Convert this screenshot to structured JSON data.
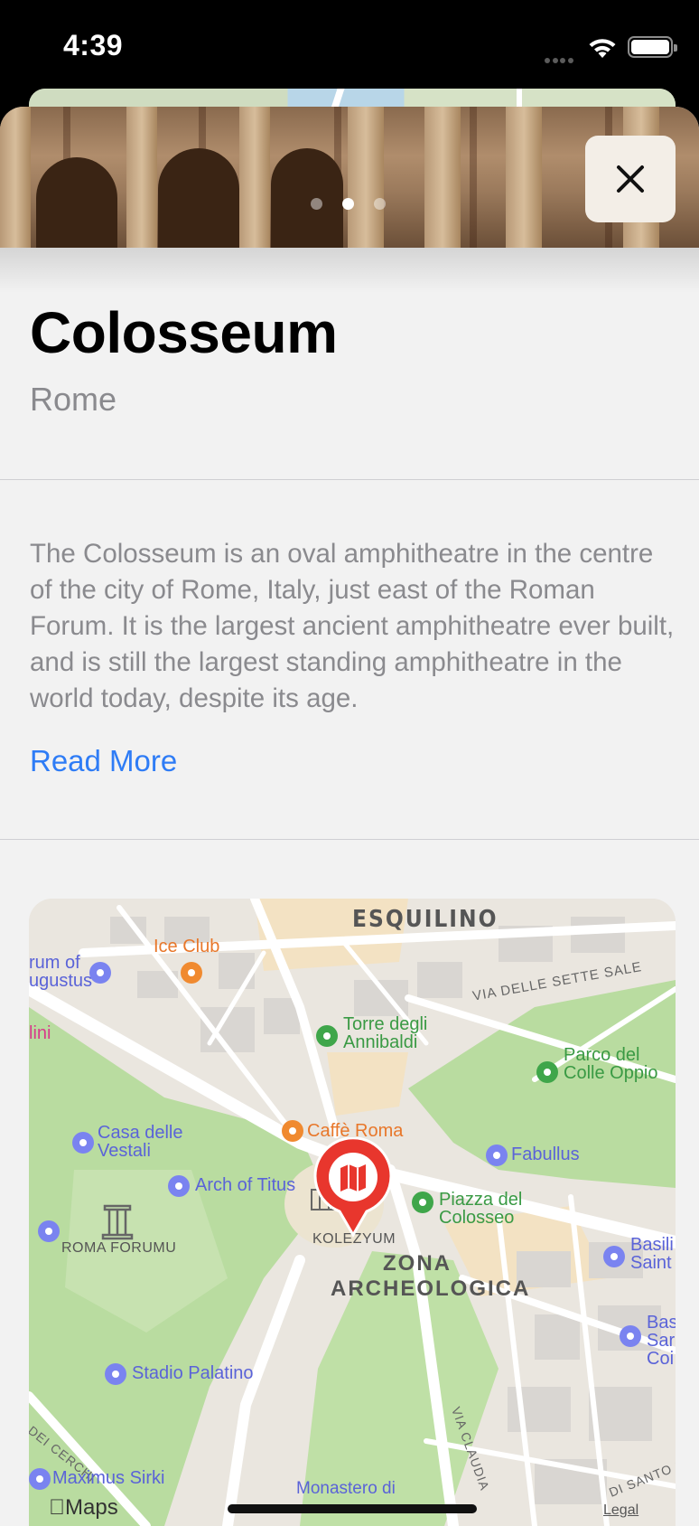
{
  "status_bar": {
    "time": "4:39"
  },
  "place": {
    "title": "Colosseum",
    "city": "Rome",
    "description": "The Colosseum is an oval amphitheatre in the centre of the city of Rome, Italy, just east of the Roman Forum. It is the largest ancient amphitheatre ever built, and is still the largest standing amphitheatre in the world today, despite its age.",
    "read_more": "Read More"
  },
  "gallery": {
    "page_count": 3,
    "active_page": 2
  },
  "map": {
    "labels": {
      "esquilino": "ESQUILINO",
      "ice_club": "Ice Club",
      "forum_augustus_1": "rum of",
      "forum_augustus_2": "ugustus",
      "lini": "lini",
      "via_sette_sale": "VIA DELLE SETTE SALE",
      "torre_1": "Torre degli",
      "torre_2": "Annibaldi",
      "parco_1": "Parco del",
      "parco_2": "Colle Oppio",
      "casa_1": "Casa delle",
      "casa_2": "Vestali",
      "caffe": "Caffè Roma",
      "fabullus": "Fabullus",
      "arch_titus": "Arch of Titus",
      "piazza_1": "Piazza del",
      "piazza_2": "Colosseo",
      "roma_forumu": "ROMA FORUMU",
      "kolezyum": "KOLEZYUM",
      "zona": "ZONA",
      "archeologica": "ARCHEOLOGICA",
      "basilica_1": "Basili",
      "basilica_2": "Saint",
      "bas2_1": "Bas",
      "bas2_2": "Sar",
      "bas2_3": "Coi",
      "stadio": "Stadio Palatino",
      "via_claudia": "VIA CLAUDIA",
      "dei_cerchi": "DEI CERCHI",
      "maximus": "Maximus Sirki",
      "monastero": "Monastero di",
      "santo_st": "DI SANTO STE",
      "maps_logo": "Maps",
      "legal": "Legal"
    },
    "colors": {
      "park": "#b9dca0",
      "road": "#ffffff",
      "pin": "#e8362d",
      "poi_purple": "#7a83f0",
      "poi_green": "#3fa64a",
      "poi_orange": "#f08a30"
    }
  }
}
